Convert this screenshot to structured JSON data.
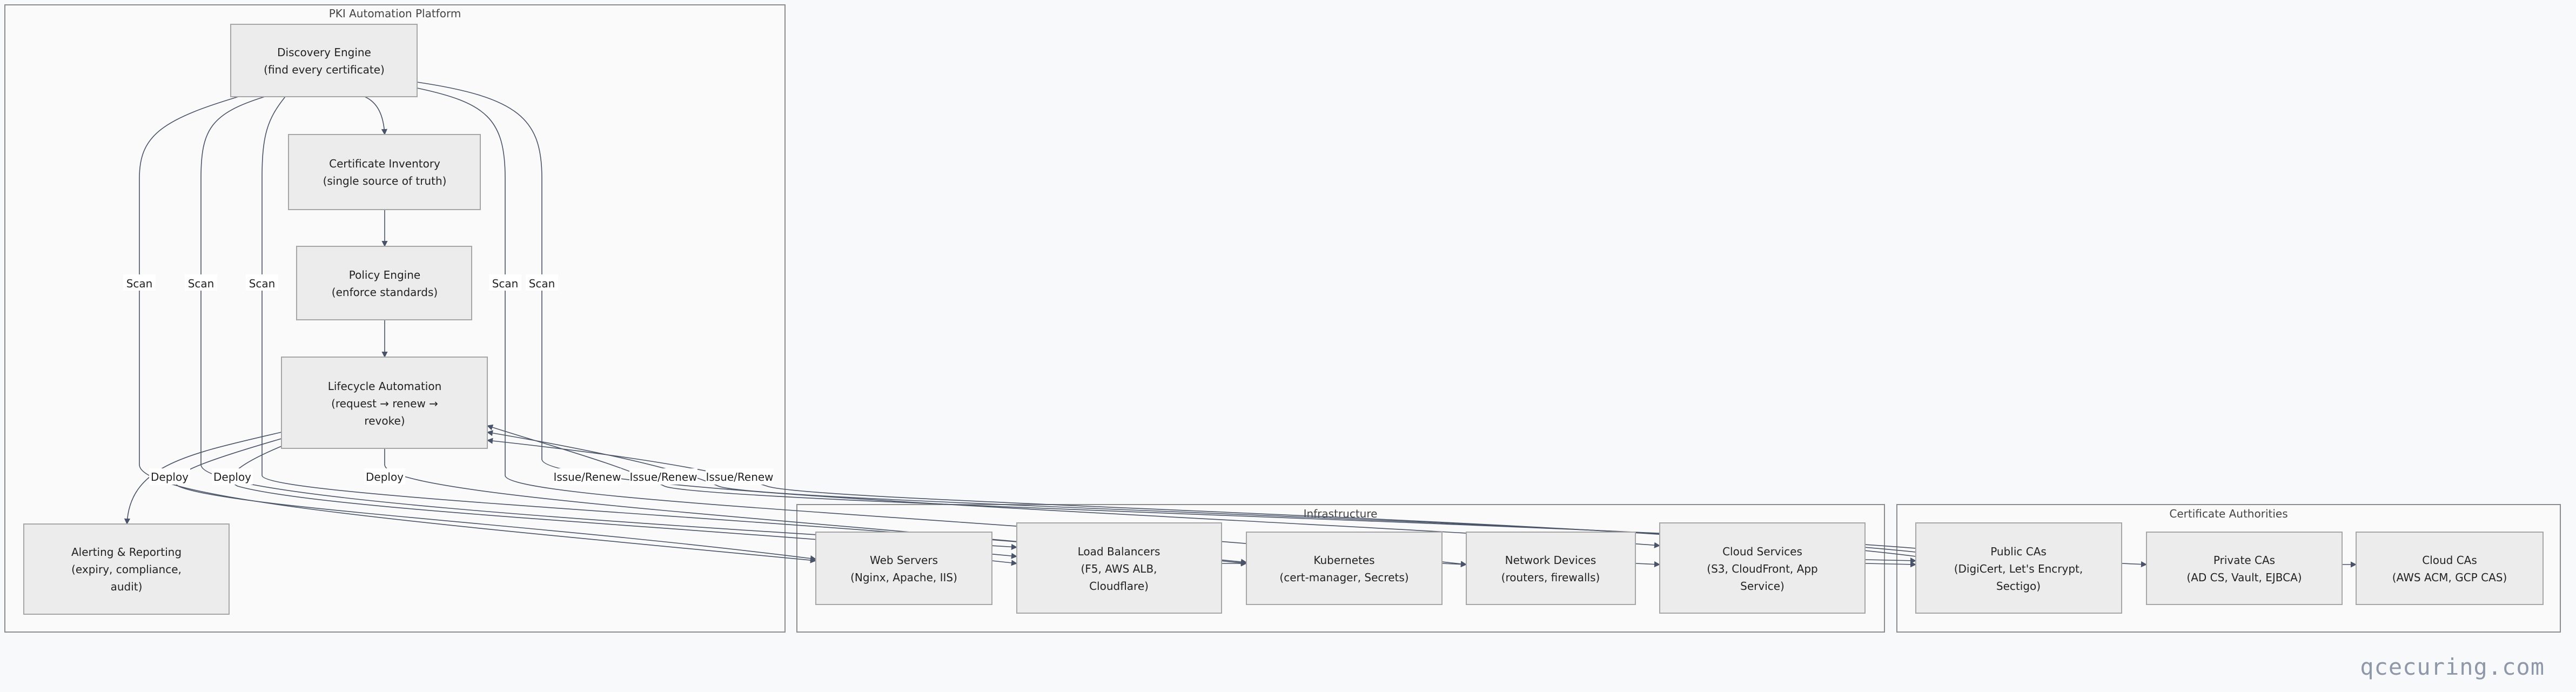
{
  "groups": {
    "pki": {
      "title": "PKI Automation Platform"
    },
    "infra": {
      "title": "Infrastructure"
    },
    "ca": {
      "title": "Certificate Authorities"
    }
  },
  "nodes": {
    "discovery": {
      "lines": [
        "Discovery Engine",
        "(find every certificate)"
      ]
    },
    "inventory": {
      "lines": [
        "Certificate Inventory",
        "(single source of truth)"
      ]
    },
    "policy": {
      "lines": [
        "Policy Engine",
        "(enforce standards)"
      ]
    },
    "lifecycle": {
      "lines": [
        "Lifecycle Automation",
        "(request → renew →",
        "revoke)"
      ]
    },
    "alerting": {
      "lines": [
        "Alerting & Reporting",
        "(expiry, compliance,",
        "audit)"
      ]
    },
    "web": {
      "lines": [
        "Web Servers",
        "(Nginx, Apache, IIS)"
      ]
    },
    "lb": {
      "lines": [
        "Load Balancers",
        "(F5, AWS ALB,",
        "Cloudflare)"
      ]
    },
    "k8s": {
      "lines": [
        "Kubernetes",
        "(cert-manager, Secrets)"
      ]
    },
    "net": {
      "lines": [
        "Network Devices",
        "(routers, firewalls)"
      ]
    },
    "cloud": {
      "lines": [
        "Cloud Services",
        "(S3, CloudFront, App",
        "Service)"
      ]
    },
    "publicca": {
      "lines": [
        "Public CAs",
        "(DigiCert, Let's Encrypt,",
        "Sectigo)"
      ]
    },
    "privateca": {
      "lines": [
        "Private CAs",
        "(AD CS, Vault, EJBCA)"
      ]
    },
    "cloudca": {
      "lines": [
        "Cloud CAs",
        "(AWS ACM, GCP CAS)"
      ]
    }
  },
  "edge_labels": {
    "scan": "Scan",
    "deploy": "Deploy",
    "issue_renew": "Issue/Renew"
  },
  "watermark": "qcecuring.com"
}
